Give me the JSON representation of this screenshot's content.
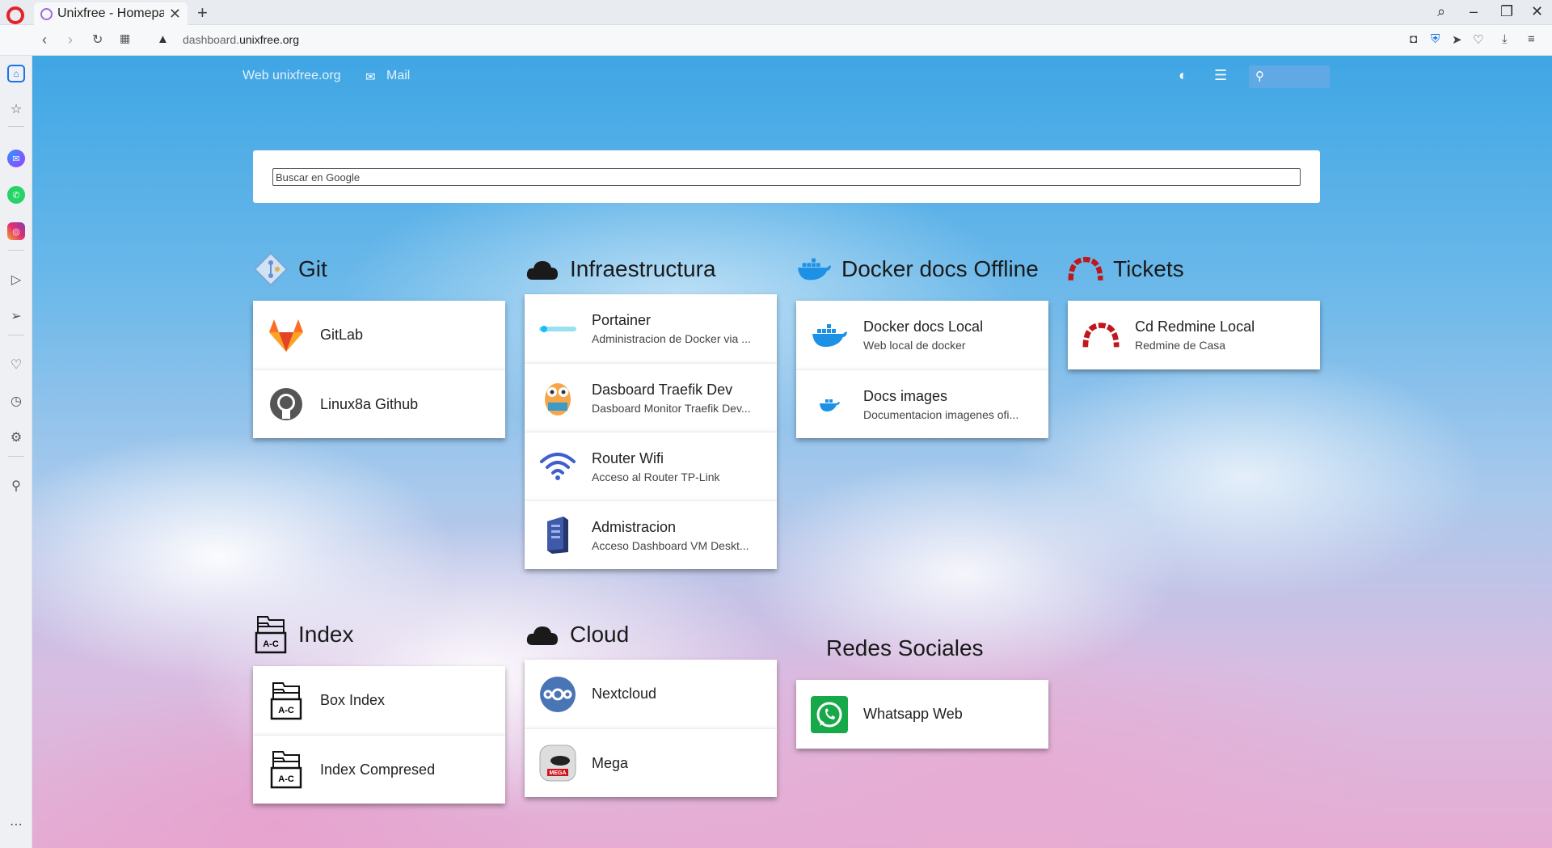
{
  "browser": {
    "tab_title": "Unixfree - Homepage",
    "new_tab": "+",
    "url_host_prefix": "dashboard.",
    "url_host_main": "unixfree.org"
  },
  "topnav": {
    "web_link": "Web unixfree.org",
    "mail_link": "Mail"
  },
  "google_search": {
    "placeholder": "Buscar en Google"
  },
  "groups": {
    "git": {
      "name": "Git",
      "items": [
        {
          "title": "GitLab",
          "subtitle": ""
        },
        {
          "title": "Linux8a Github",
          "subtitle": ""
        }
      ]
    },
    "infra": {
      "name": "Infraestructura",
      "items": [
        {
          "title": "Portainer",
          "subtitle": "Administracion de Docker via ..."
        },
        {
          "title": "Dasboard Traefik Dev",
          "subtitle": "Dasboard Monitor Traefik Dev..."
        },
        {
          "title": "Router Wifi",
          "subtitle": "Acceso al Router TP-Link"
        },
        {
          "title": "Admistracion",
          "subtitle": "Acceso Dashboard VM Deskt..."
        }
      ]
    },
    "docker": {
      "name": "Docker docs Offline",
      "items": [
        {
          "title": "Docker docs Local",
          "subtitle": "Web local de docker"
        },
        {
          "title": "Docs images",
          "subtitle": "Documentacion imagenes ofi..."
        }
      ]
    },
    "tickets": {
      "name": "Tickets",
      "items": [
        {
          "title": "Cd Redmine Local",
          "subtitle": "Redmine de Casa"
        }
      ]
    },
    "index": {
      "name": "Index",
      "items": [
        {
          "title": "Box Index",
          "subtitle": ""
        },
        {
          "title": "Index Compresed",
          "subtitle": ""
        }
      ]
    },
    "cloud": {
      "name": "Cloud",
      "items": [
        {
          "title": "Nextcloud",
          "subtitle": ""
        },
        {
          "title": "Mega",
          "subtitle": ""
        }
      ]
    },
    "social": {
      "name": "Redes Sociales",
      "items": [
        {
          "title": "Whatsapp Web",
          "subtitle": ""
        }
      ]
    }
  },
  "icon_labels": {
    "index_icon_text": "A-C",
    "mega_text": "MEGA"
  },
  "colors": {
    "gitlab": "#e24329",
    "redmine": "#b32024",
    "docker": "#1d91e6",
    "nextcloud": "#4a75b5",
    "whatsapp": "#25d366"
  }
}
